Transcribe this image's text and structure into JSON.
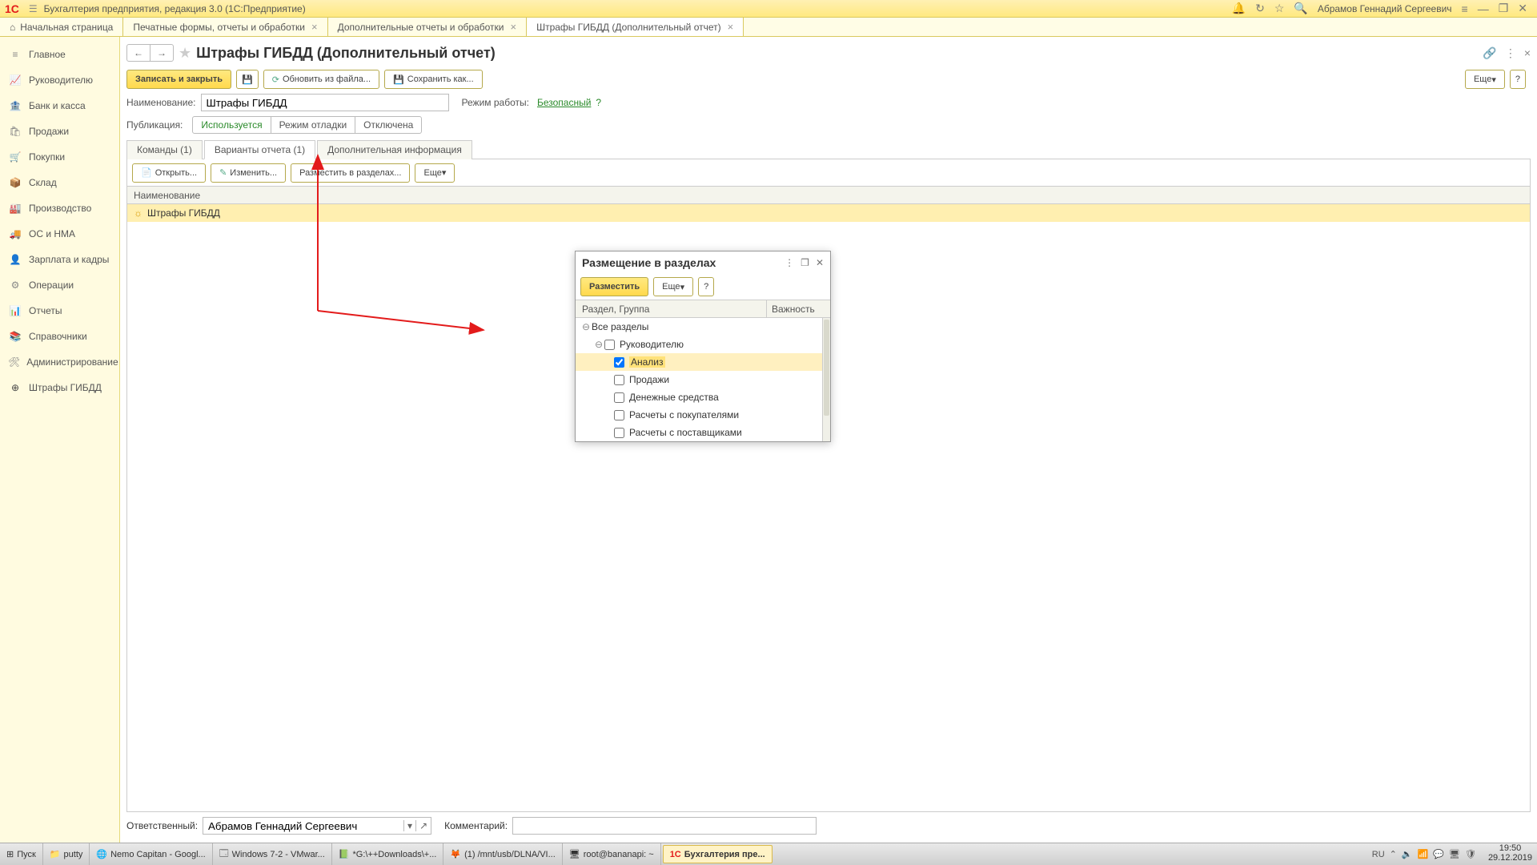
{
  "titlebar": {
    "app_title": "Бухгалтерия предприятия, редакция 3.0  (1С:Предприятие)",
    "user": "Абрамов Геннадий Сергеевич"
  },
  "tabs": {
    "home": "Начальная страница",
    "t1": "Печатные формы, отчеты и обработки",
    "t2": "Дополнительные отчеты и обработки",
    "t3": "Штрафы ГИБДД (Дополнительный отчет)"
  },
  "sidebar": [
    {
      "icon": "≡",
      "label": "Главное"
    },
    {
      "icon": "📈",
      "label": "Руководителю"
    },
    {
      "icon": "🏦",
      "label": "Банк и касса"
    },
    {
      "icon": "🛍",
      "label": "Продажи"
    },
    {
      "icon": "🛒",
      "label": "Покупки"
    },
    {
      "icon": "📦",
      "label": "Склад"
    },
    {
      "icon": "🏭",
      "label": "Производство"
    },
    {
      "icon": "🚚",
      "label": "ОС и НМА"
    },
    {
      "icon": "👤",
      "label": "Зарплата и кадры"
    },
    {
      "icon": "⚙",
      "label": "Операции"
    },
    {
      "icon": "📊",
      "label": "Отчеты"
    },
    {
      "icon": "📚",
      "label": "Справочники"
    },
    {
      "icon": "🛠",
      "label": "Администрирование"
    },
    {
      "icon": "⊕",
      "label": "Штрафы ГИБДД"
    }
  ],
  "page": {
    "title": "Штрафы ГИБДД (Дополнительный отчет)",
    "save_close": "Записать и закрыть",
    "update_file": "Обновить из файла...",
    "save_as": "Сохранить как...",
    "more": "Еще",
    "help": "?",
    "name_label": "Наименование:",
    "name_value": "Штрафы ГИБДД",
    "mode_label": "Режим работы:",
    "mode_value": "Безопасный",
    "pub_label": "Публикация:",
    "pub_opts": {
      "a": "Используется",
      "b": "Режим отладки",
      "c": "Отключена"
    },
    "subtabs": {
      "a": "Команды (1)",
      "b": "Варианты отчета (1)",
      "c": "Дополнительная информация"
    },
    "open": "Открыть...",
    "edit": "Изменить...",
    "place": "Разместить в разделах...",
    "grid_col": "Наименование",
    "row1": "Штрафы ГИБДД",
    "resp_label": "Ответственный:",
    "resp_value": "Абрамов Геннадий Сергеевич",
    "comment_label": "Комментарий:"
  },
  "dialog": {
    "title": "Размещение в разделах",
    "place": "Разместить",
    "more": "Еще",
    "help": "?",
    "col1": "Раздел, Группа",
    "col2": "Важность",
    "items": [
      {
        "label": "Все разделы",
        "indent": 0,
        "exp": "⊖"
      },
      {
        "label": "Руководителю",
        "indent": 1,
        "exp": "⊖",
        "chk": false
      },
      {
        "label": "Анализ",
        "indent": 2,
        "chk": true,
        "sel": true
      },
      {
        "label": "Продажи",
        "indent": 2,
        "chk": false
      },
      {
        "label": "Денежные средства",
        "indent": 2,
        "chk": false
      },
      {
        "label": "Расчеты с покупателями",
        "indent": 2,
        "chk": false
      },
      {
        "label": "Расчеты с поставщиками",
        "indent": 2,
        "chk": false
      }
    ]
  },
  "taskbar": {
    "start": "Пуск",
    "items": [
      {
        "ic": "📁",
        "label": "putty"
      },
      {
        "ic": "🌐",
        "label": "Nemo Capitan - Googl..."
      },
      {
        "ic": "🗔",
        "label": "Windows 7-2 - VMwar..."
      },
      {
        "ic": "📗",
        "label": "*G:\\++Downloads\\+..."
      },
      {
        "ic": "🦊",
        "label": "(1) /mnt/usb/DLNA/VI..."
      },
      {
        "ic": "🖥",
        "label": "root@bananapi: ~"
      },
      {
        "ic": "1С",
        "label": "Бухгалтерия пре...",
        "active": true
      }
    ],
    "lang": "RU",
    "time": "19:50",
    "date": "29.12.2019"
  }
}
